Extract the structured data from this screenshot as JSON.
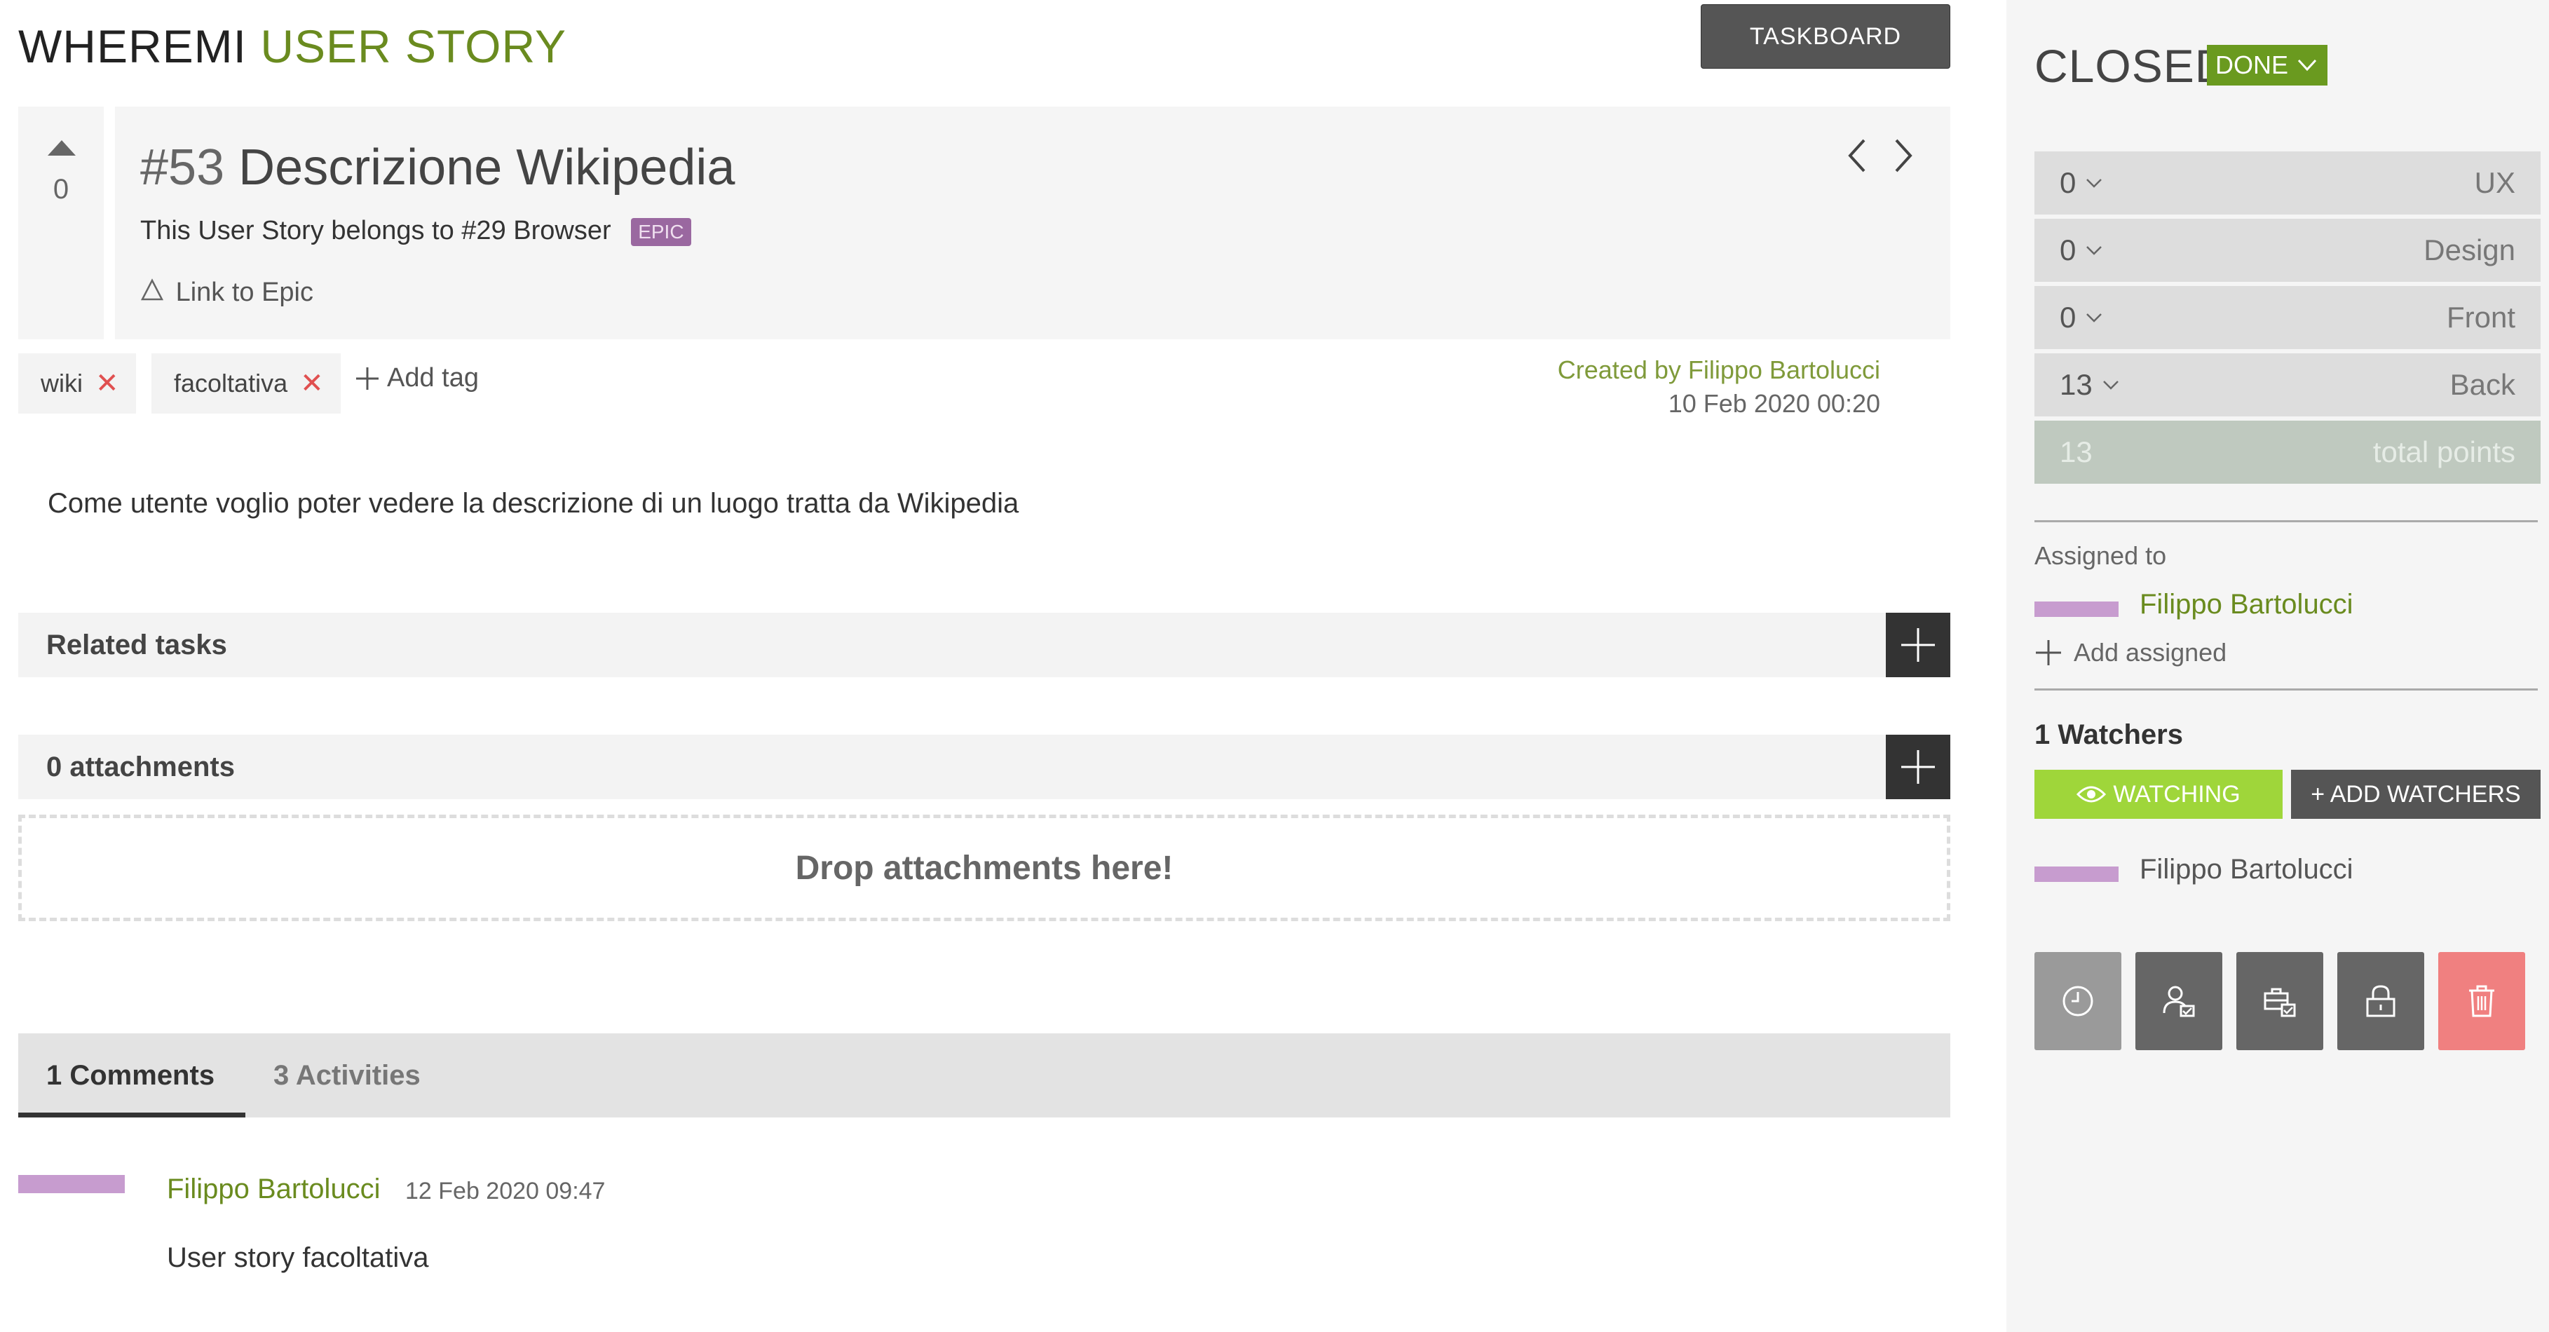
{
  "header": {
    "project_name": "WHEREMI",
    "item_type": "USER STORY",
    "taskboard_label": "TASKBOARD"
  },
  "story": {
    "vote_count": "0",
    "ref": "#53",
    "title": "Descrizione Wikipedia",
    "belongs_text": "This User Story belongs to #29 Browser",
    "epic_badge": "EPIC",
    "link_epic_label": "Link to Epic",
    "description": "Come utente voglio poter vedere la descrizione di un luogo tratta da Wikipedia"
  },
  "tags": {
    "items": [
      "wiki",
      "facoltativa"
    ],
    "add_label": "Add tag"
  },
  "meta": {
    "created_by": "Created by Filippo Bartolucci",
    "created_date": "10 Feb 2020 00:20"
  },
  "sections": {
    "related_tasks": "Related tasks",
    "attachments": "0 attachments",
    "drop_zone": "Drop attachments here!"
  },
  "tabs": {
    "comments": "1 Comments",
    "activities": "3 Activities"
  },
  "comment": {
    "author": "Filippo Bartolucci",
    "date": "12 Feb 2020 09:47",
    "text": "User story facoltativa"
  },
  "sidebar": {
    "status_label": "CLOSED",
    "status_value": "DONE",
    "points": [
      {
        "value": "0",
        "role": "UX"
      },
      {
        "value": "0",
        "role": "Design"
      },
      {
        "value": "0",
        "role": "Front"
      },
      {
        "value": "13",
        "role": "Back"
      }
    ],
    "total": {
      "value": "13",
      "label": "total points"
    },
    "assigned_label": "Assigned to",
    "assignee": "Filippo Bartolucci",
    "add_assigned": "Add assigned",
    "watchers_title": "1 Watchers",
    "watching_label": "WATCHING",
    "add_watchers_label": "+ ADD WATCHERS",
    "watcher": "Filippo Bartolucci"
  },
  "colors": {
    "accent_green": "#6a8b1f",
    "watching_green": "#9fd63a",
    "avatar_purple": "#c79ccf",
    "epic_purple": "#9a68a0",
    "delete_red": "#f08080"
  }
}
